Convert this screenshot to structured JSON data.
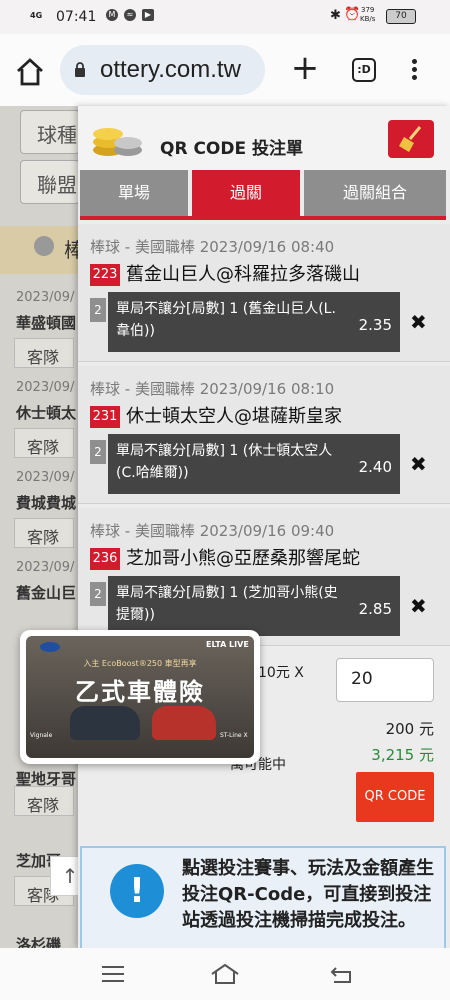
{
  "status_bar": {
    "network": "4G",
    "time": "07:41",
    "speed_value": "379",
    "speed_unit": "KB/s",
    "battery": "70"
  },
  "browser": {
    "url": "ottery.com.tw",
    "tab_label": ":D"
  },
  "background_page": {
    "buttons": [
      "球種",
      "聯盟"
    ],
    "strip_text": "棒",
    "rows": [
      {
        "date": "2023/09/",
        "team": "華盛頓國",
        "chip": "客隊"
      },
      {
        "date": "2023/09/",
        "team": "休士頓太",
        "chip": "客隊"
      },
      {
        "date": "2023/09/",
        "team": "費城費城",
        "chip": "客隊"
      },
      {
        "date": "2023/09/",
        "team": "舊金山巨",
        "chip": "客隊"
      },
      {
        "date": "",
        "team": "聖地牙哥",
        "chip": "客隊"
      },
      {
        "date": "",
        "team": "芝加哥",
        "chip": "客隊"
      },
      {
        "date": "",
        "team": "洛杉磯",
        "chip": ""
      }
    ],
    "up_icon": "↑"
  },
  "panel": {
    "title": "QR CODE 投注單",
    "tabs": [
      "單場",
      "過關",
      "過關組合"
    ],
    "bets": [
      {
        "league": "棒球 - 美國職棒 2023/09/16 08:40",
        "number": "223",
        "match": "舊金山巨人@科羅拉多落磯山",
        "index": "2",
        "selection": "單局不讓分[局數] 1 (舊金山巨人(L.韋伯))",
        "odds": "2.35"
      },
      {
        "league": "棒球 - 美國職棒 2023/09/16 08:10",
        "number": "231",
        "match": "休士頓太空人@堪薩斯皇家",
        "index": "2",
        "selection": "單局不讓分[局數] 1 (休士頓太空人(C.哈維爾))",
        "odds": "2.40"
      },
      {
        "league": "棒球 - 美國職棒 2023/09/16 09:40",
        "number": "236",
        "match": "芝加哥小熊@亞歷桑那響尾蛇",
        "index": "2",
        "selection": "單局不讓分[局數] 1 (芝加哥小熊(史提爾))",
        "odds": "2.85"
      }
    ],
    "summary": {
      "amount_label": "金額10元 X",
      "amount_value": "20",
      "total_label": "萬可能中",
      "total_value": "200 元",
      "win_value": "3,215 元",
      "qr_button": "QR CODE"
    },
    "info_text": "點選投注賽事、玩法及金額產生投注QR-Code，可直接到投注站透過投注機掃描完成投注。",
    "info_icon": "!"
  },
  "ad": {
    "brand": "ELTA LIVE",
    "subtitle": "入主 EcoBoost®250 車型再享",
    "title": "乙式車體險",
    "caption_left": "Vignale",
    "caption_right": "ST-Line X"
  }
}
